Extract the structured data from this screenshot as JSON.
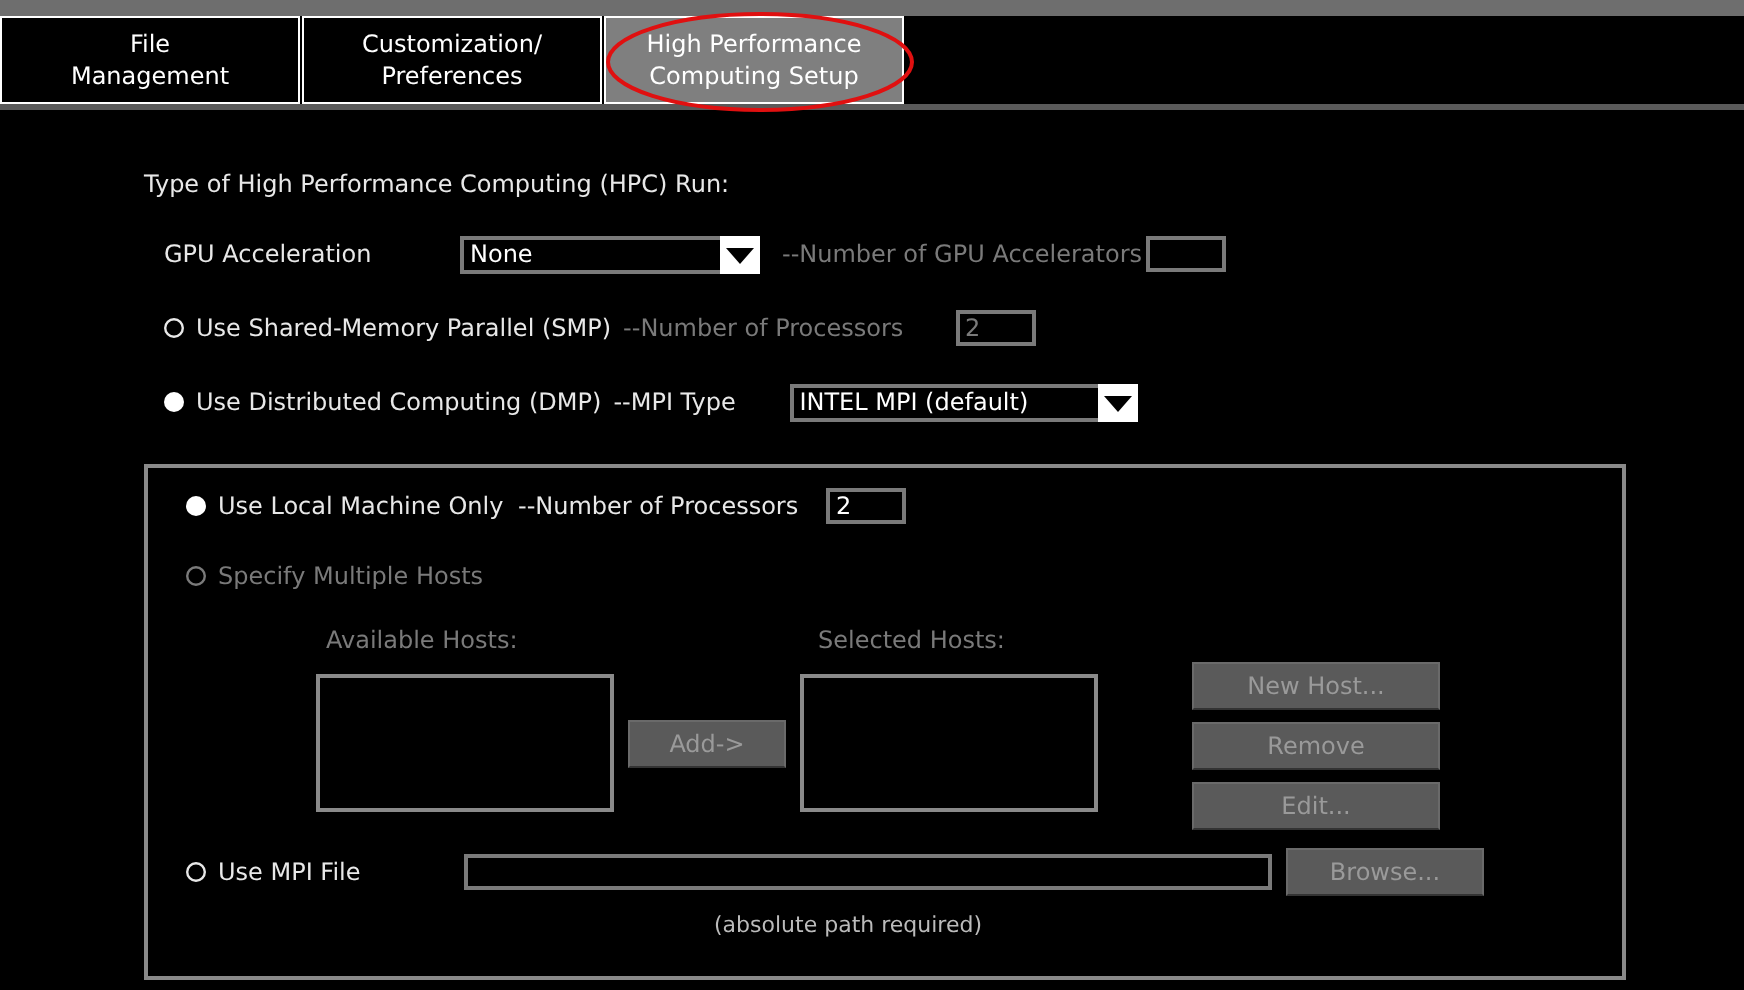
{
  "tabs": [
    {
      "label": "File\nManagement",
      "selected": false
    },
    {
      "label": "Customization/\nPreferences",
      "selected": false
    },
    {
      "label": "High Performance\nComputing Setup",
      "selected": true
    }
  ],
  "hpc": {
    "heading": "Type of High Performance Computing (HPC) Run:",
    "gpu": {
      "label": "GPU Acceleration",
      "value": "None",
      "count_label": "--Number of GPU Accelerators",
      "count_disabled": true
    },
    "modes": [
      {
        "label": "Use Shared-Memory Parallel (SMP)",
        "selected": false,
        "option_label": "--Number of Processors",
        "kind": "field",
        "option_value": "2",
        "option_disabled": true
      },
      {
        "label": "Use Distributed Computing (DMP)",
        "selected": true,
        "option_label": "--MPI Type",
        "kind": "dropdown",
        "option_value": "INTEL MPI (default)",
        "option_disabled": false
      }
    ]
  },
  "dmp": {
    "local": {
      "label": "Use Local Machine Only",
      "selected": true,
      "disabled": false,
      "processors_label": "--Number of Processors",
      "processors": "2"
    },
    "hosts": {
      "label": "Specify Multiple Hosts",
      "selected": false,
      "disabled": true,
      "available_label": "Available Hosts:",
      "selected_label": "Selected Hosts:",
      "add_button": "Add->",
      "buttons": [
        "New Host...",
        "Remove",
        "Edit..."
      ]
    },
    "mpi_file": {
      "label": "Use MPI File",
      "selected": false,
      "disabled": false,
      "browse_button": "Browse...",
      "note": "(absolute path required)"
    }
  }
}
